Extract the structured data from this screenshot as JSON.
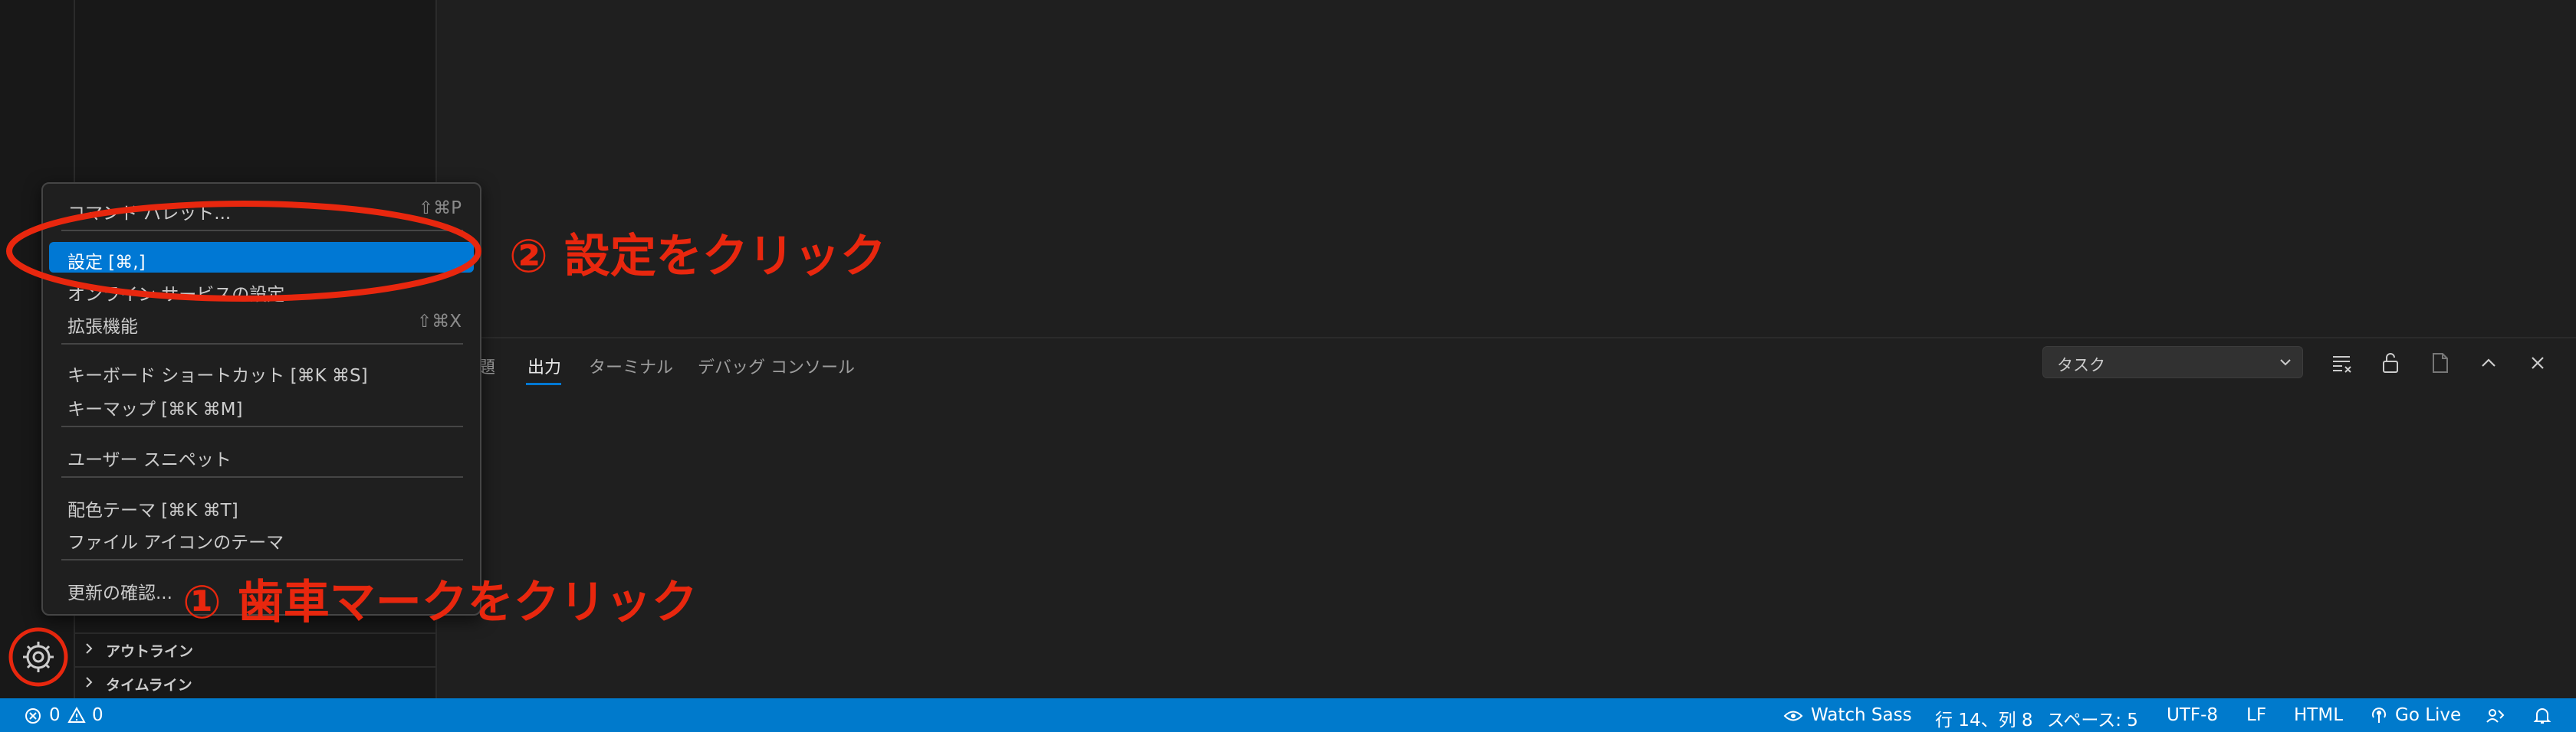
{
  "panel": {
    "tabs": [
      {
        "label": "題"
      },
      {
        "label": "出力"
      },
      {
        "label": "ターミナル"
      },
      {
        "label": "デバッグ コンソール"
      }
    ],
    "task_select": "タスク"
  },
  "sidebar": {
    "sections": [
      {
        "label": "アウトライン"
      },
      {
        "label": "タイムライン"
      }
    ]
  },
  "menu": {
    "items": [
      {
        "label": "コマンド パレット...",
        "shortcut": "⇧⌘P"
      },
      {
        "label": "設定 [⌘,]",
        "shortcut": ""
      },
      {
        "label": "オンライン サービスの設定",
        "shortcut": ""
      },
      {
        "label": "拡張機能",
        "shortcut": "⇧⌘X"
      },
      {
        "label": "キーボード ショートカット [⌘K ⌘S]",
        "shortcut": ""
      },
      {
        "label": "キーマップ [⌘K ⌘M]",
        "shortcut": ""
      },
      {
        "label": "ユーザー スニペット",
        "shortcut": ""
      },
      {
        "label": "配色テーマ [⌘K ⌘T]",
        "shortcut": ""
      },
      {
        "label": "ファイル アイコンのテーマ",
        "shortcut": ""
      },
      {
        "label": "更新の確認...",
        "shortcut": ""
      }
    ]
  },
  "statusbar": {
    "errors": "0",
    "warnings": "0",
    "watch_sass": "Watch Sass",
    "position": "行 14、列 8",
    "spaces": "スペース: 5",
    "encoding": "UTF-8",
    "eol": "LF",
    "language": "HTML",
    "go_live": "Go Live"
  },
  "annotations": {
    "step1": "① 歯車マークをクリック",
    "step2": "② 設定をクリック"
  },
  "colors": {
    "accent": "#0078d4",
    "statusbar": "#007acc",
    "annotation": "#e8270e"
  }
}
